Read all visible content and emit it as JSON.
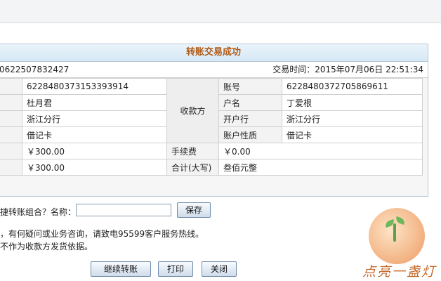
{
  "panel": {
    "title": "转账交易成功",
    "serial_fragment": "0622507832427",
    "time_label": "交易时间：",
    "time_value": "2015年07月06日 22:51:34"
  },
  "payer": {
    "account": "6228480373153393914",
    "name": "杜月君",
    "bank": "浙江分行",
    "card_type": "借记卡",
    "amount": "￥300.00",
    "total": "￥300.00"
  },
  "payee": {
    "group_label": "收款方",
    "account_label": "账号",
    "account": "6228480372705869611",
    "name_label": "户名",
    "name": "丁爱根",
    "bank_label": "开户行",
    "bank": "浙江分行",
    "type_label": "账户性质",
    "card_type": "借记卡"
  },
  "fees": {
    "fee_label": "手续费",
    "fee_value": "￥0.00",
    "total_label": "合计(大写)",
    "total_value": "叁佰元整"
  },
  "combo": {
    "prompt": "捷转账组合？名称：",
    "name_value": "",
    "save_label": "保存"
  },
  "notes": {
    "line1": "，有何疑问或业务咨询，请致电95599客户服务热线。",
    "line2": "不作为收款方发货依据。"
  },
  "actions": {
    "continue_label": "继续转账",
    "print_label": "打印",
    "close_label": "关闭"
  },
  "watermark": {
    "text": "点亮一盏灯",
    "icon": "lamp-sprout-icon"
  }
}
